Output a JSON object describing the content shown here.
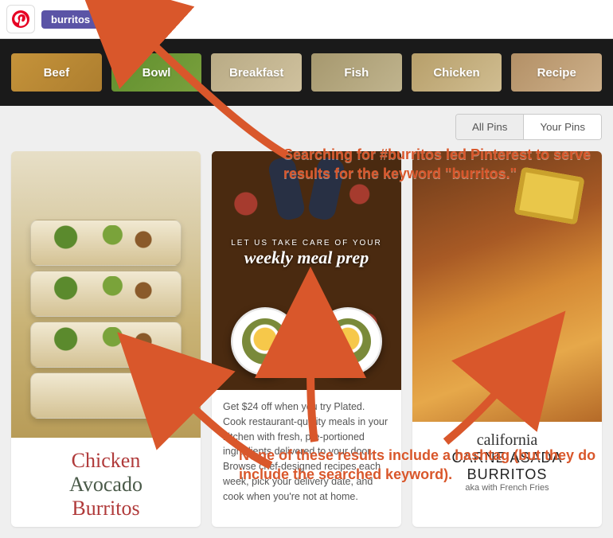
{
  "search": {
    "tag": "burritos",
    "tag_close": "×"
  },
  "categories": [
    "Beef",
    "Bowl",
    "Breakfast",
    "Fish",
    "Chicken",
    "Recipe"
  ],
  "tabs": {
    "all": "All Pins",
    "your": "Your Pins"
  },
  "pins": [
    {
      "title_line1": "Chicken",
      "title_line2": "Avocado",
      "title_line3": "Burritos"
    },
    {
      "overlay_small": "LET US TAKE CARE OF YOUR",
      "overlay_big": "weekly meal prep",
      "desc": "Get $24 off when you try Plated. Cook restaurant-quality meals in your kitchen with fresh, pre-portioned ingredients delivered to your door. Browse chef-designed recipes each week, pick your delivery date, and cook when you're not at home."
    },
    {
      "cali": "california",
      "carne": "CARNE ASADA BURRITOS",
      "aka": "aka with French Fries"
    }
  ],
  "annotations": {
    "a1": "Searching for #burritos led Pinterest to serve results for the keyword \"burritos.\"",
    "a2": "None of these results include a hashtag (but they do include the searched keyword)."
  }
}
